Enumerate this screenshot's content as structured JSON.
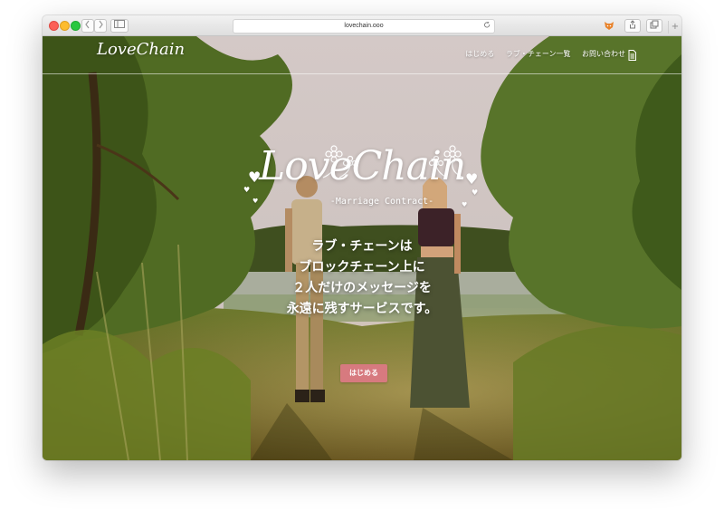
{
  "browser": {
    "url": "lovechain.ooo",
    "back_icon": "chevron-left-icon",
    "forward_icon": "chevron-right-icon",
    "sidebar_icon": "sidebar-icon",
    "reload_icon": "reload-icon",
    "extension_icon": "fox-extension-icon",
    "share_icon": "share-icon",
    "tabs_icon": "tabs-icon",
    "new_tab": "+"
  },
  "site": {
    "logo": "LoveChain",
    "nav": [
      "はじめる",
      "ラブ・チェーン一覧",
      "お問い合わせ"
    ],
    "doc_icon": "document-icon"
  },
  "hero": {
    "logo": "LoveChain",
    "subtitle": "-Marriage Contract-",
    "lines": [
      "ラブ・チェーンは",
      "ブロックチェーン上に",
      "２人だけのメッセージを",
      "永遠に残すサービスです。"
    ],
    "cta_label": "はじめる"
  },
  "colors": {
    "cta": "#d77a7f",
    "sky": "#cfc5c2"
  }
}
